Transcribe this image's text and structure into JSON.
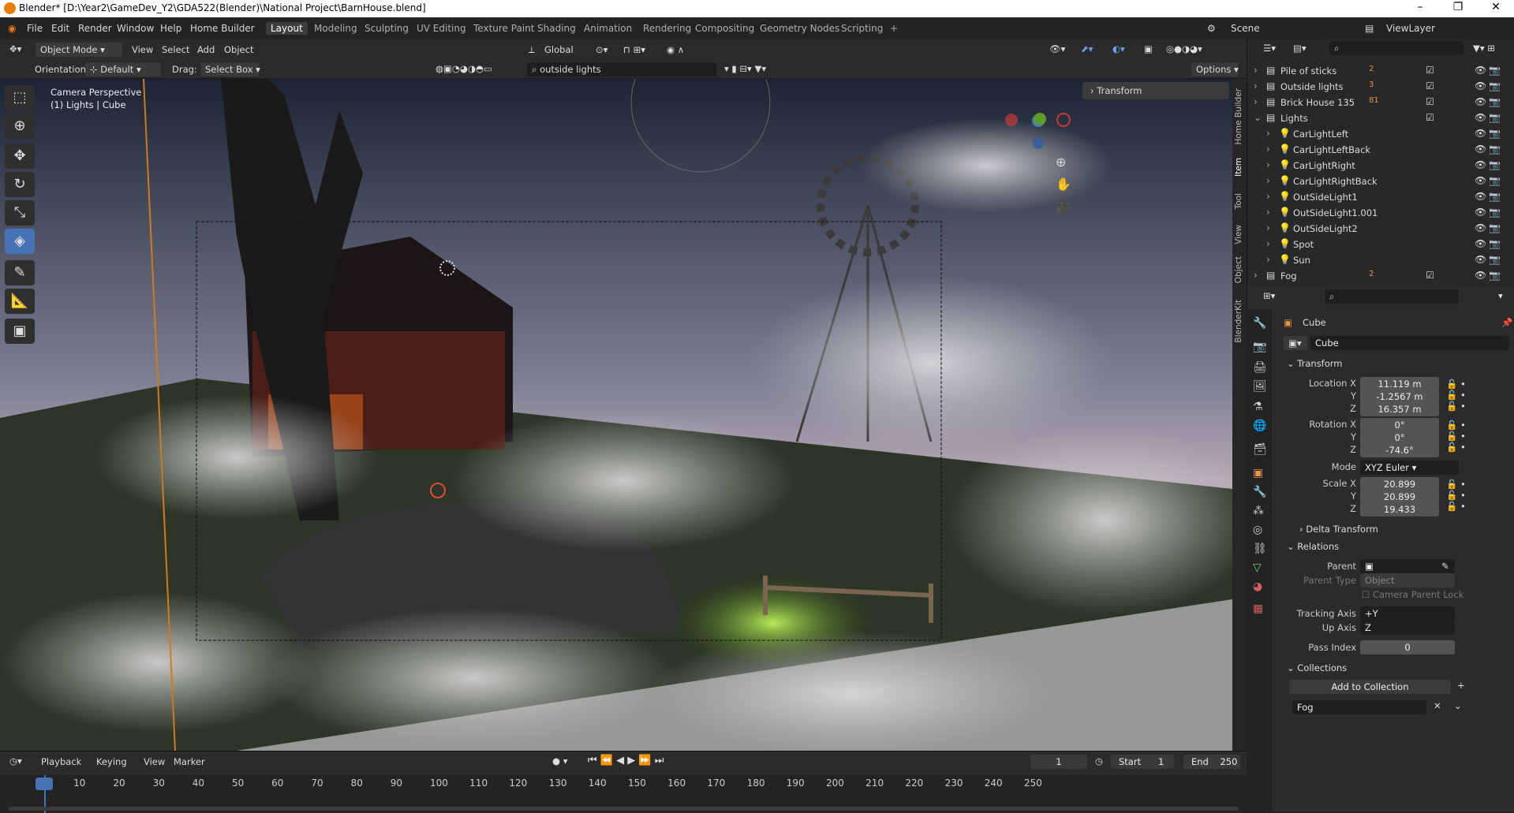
{
  "title": "Blender* [D:\\Year2\\GameDev_Y2\\GDA522(Blender)\\National Project\\BarnHouse.blend]",
  "window_controls": [
    "–",
    "❐",
    "✕"
  ],
  "menu": [
    "File",
    "Edit",
    "Render",
    "Window",
    "Help",
    "Home Builder"
  ],
  "workspaces": [
    "Layout",
    "Modeling",
    "Sculpting",
    "UV Editing",
    "Texture Paint",
    "Shading",
    "Animation",
    "Rendering",
    "Compositing",
    "Geometry Nodes",
    "Scripting",
    "+"
  ],
  "scene": "Scene",
  "view_layer": "ViewLayer",
  "header": {
    "mode": "Object Mode",
    "view": "View",
    "select": "Select",
    "add": "Add",
    "object": "Object",
    "orientation_global": "Global"
  },
  "toolbar": {
    "orientation_label": "Orientation:",
    "orientation_value": "Default",
    "drag_label": "Drag:",
    "drag_value": "Select Box",
    "search": "outside lights",
    "options": "Options"
  },
  "viewport": {
    "camera": "Camera Perspective",
    "selection": "(1) Lights | Cube",
    "transform_panel": "Transform"
  },
  "npanel_tabs": [
    "Home Builder",
    "Item",
    "Tool",
    "View",
    "Object",
    "BlenderKit"
  ],
  "outliner": [
    {
      "name": "Pile of sticks",
      "indent": 0,
      "count": "2"
    },
    {
      "name": "Outside lights",
      "indent": 0,
      "count": "3"
    },
    {
      "name": "Brick House 135",
      "indent": 0,
      "count": "81"
    },
    {
      "name": "Lights",
      "indent": 0,
      "open": true
    },
    {
      "name": "CarLightLeft",
      "indent": 1
    },
    {
      "name": "CarLightLeftBack",
      "indent": 1
    },
    {
      "name": "CarLightRight",
      "indent": 1
    },
    {
      "name": "CarLightRightBack",
      "indent": 1
    },
    {
      "name": "OutSideLight1",
      "indent": 1
    },
    {
      "name": "OutSideLight1.001",
      "indent": 1
    },
    {
      "name": "OutSideLight2",
      "indent": 1
    },
    {
      "name": "Spot",
      "indent": 1
    },
    {
      "name": "Sun",
      "indent": 1
    },
    {
      "name": "Fog",
      "indent": 0,
      "count": "2"
    }
  ],
  "props": {
    "object": "Cube",
    "datablock": "Cube",
    "transform": "Transform",
    "location_label": "Location X",
    "loc_x": "11.119 m",
    "loc_y": "-1.2567 m",
    "loc_z": "16.357 m",
    "rotation_label": "Rotation X",
    "rot_x": "0°",
    "rot_y": "0°",
    "rot_z": "-74.6°",
    "mode_label": "Mode",
    "mode": "XYZ Euler",
    "scale_label": "Scale X",
    "scale_x": "20.899",
    "scale_y": "20.899",
    "scale_z": "19.433",
    "y": "Y",
    "z": "Z",
    "delta": "Delta Transform",
    "relations": "Relations",
    "parent_label": "Parent",
    "parent_type_label": "Parent Type",
    "parent_type": "Object",
    "camera_parent_lock": "Camera Parent Lock",
    "tracking_label": "Tracking Axis",
    "tracking": "+Y",
    "up_label": "Up Axis",
    "up": "Z",
    "pass_label": "Pass Index",
    "pass": "0",
    "collections": "Collections",
    "add_collection": "Add to Collection",
    "collection_name": "Fog"
  },
  "timeline": {
    "playback": "Playback",
    "keying": "Keying",
    "view": "View",
    "marker": "Marker",
    "frame": "1",
    "start_label": "Start",
    "start": "1",
    "end_label": "End",
    "end": "250",
    "ticks": [
      "1",
      "10",
      "20",
      "30",
      "40",
      "50",
      "60",
      "70",
      "80",
      "90",
      "100",
      "110",
      "120",
      "130",
      "140",
      "150",
      "160",
      "170",
      "180",
      "190",
      "200",
      "210",
      "220",
      "230",
      "240",
      "250"
    ]
  }
}
